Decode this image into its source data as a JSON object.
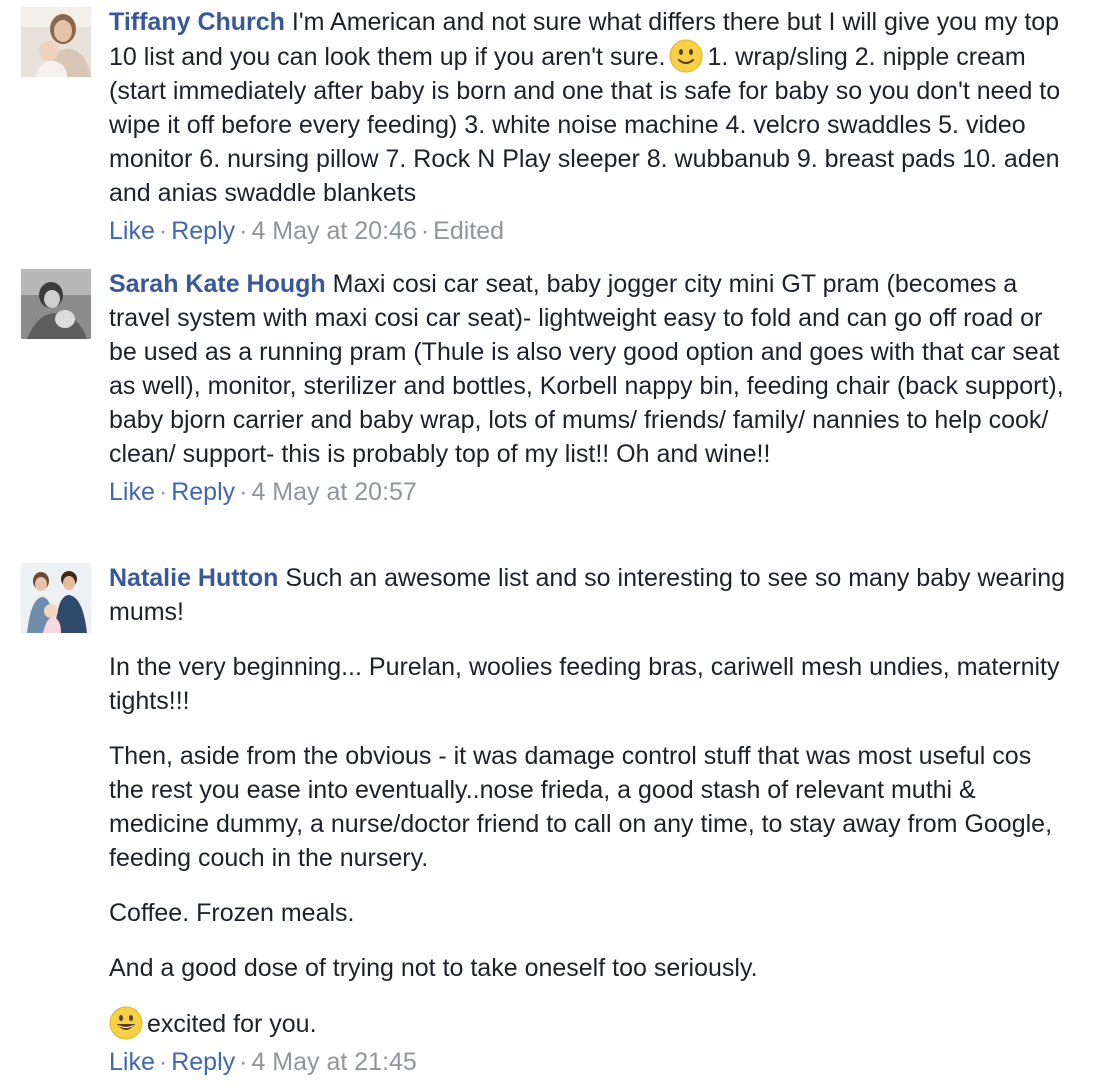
{
  "comments": [
    {
      "author": "Tiffany Church",
      "paragraphs": [
        {
          "before_emoji": "I'm American and not sure what differs there but I will give you my top 10 list and you can look them up if you aren't sure.",
          "emoji": "slightly-smiling-face",
          "after_emoji": "1. wrap/sling 2. nipple cream (start immediately after baby is born and one that is safe for baby so you don't need to wipe it off before every feeding) 3. white noise machine 4. velcro swaddles 5. video monitor 6. nursing pillow 7. Rock N Play sleeper 8. wubbanub 9. breast pads 10. aden and anias swaddle blankets"
        }
      ],
      "like_label": "Like",
      "reply_label": "Reply",
      "timestamp": "4 May at 20:46",
      "edited_label": "Edited"
    },
    {
      "author": "Sarah Kate Hough",
      "paragraphs": [
        {
          "text": "Maxi cosi car seat, baby jogger city mini GT pram (becomes a travel system with maxi cosi car seat)- lightweight easy to fold and can go off road or be used as a running pram (Thule is also very good option and goes with that car seat as well), monitor, sterilizer and bottles, Korbell nappy bin, feeding chair (back support), baby bjorn carrier and baby wrap, lots of mums/ friends/ family/ nannies to help cook/ clean/ support- this is probably top of my list!! Oh and wine!!"
        }
      ],
      "like_label": "Like",
      "reply_label": "Reply",
      "timestamp": "4 May at 20:57"
    },
    {
      "author": "Natalie Hutton",
      "paragraphs": [
        {
          "text": "Such an awesome list and so interesting to see so many baby wearing mums!"
        },
        {
          "text": "In the very beginning... Purelan, woolies feeding bras, cariwell mesh undies, maternity tights!!!"
        },
        {
          "text": "Then, aside from the obvious - it was damage control stuff that was most useful cos the rest you ease into eventually..nose frieda, a good stash of relevant muthi & medicine dummy, a nurse/doctor friend to call on any time, to stay away from Google, feeding couch in the nursery."
        },
        {
          "text": "Coffee. Frozen meals."
        },
        {
          "text": "And a good dose of trying not to take oneself too seriously."
        },
        {
          "emoji": "grinning-face",
          "text": "excited for you."
        }
      ],
      "like_label": "Like",
      "reply_label": "Reply",
      "timestamp": "4 May at 21:45"
    }
  ],
  "separator": "·",
  "colors": {
    "author": "#385898",
    "action_link": "#4267b2",
    "meta": "#90949c",
    "text": "#1d2129"
  }
}
